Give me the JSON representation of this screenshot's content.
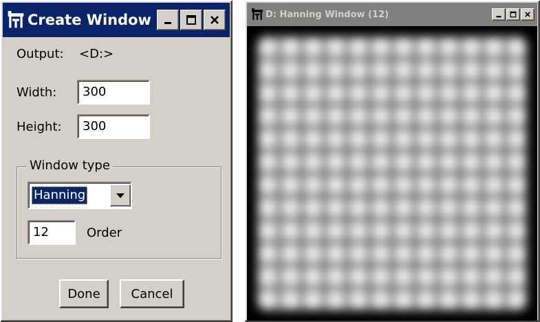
{
  "create_window": {
    "title": "Create Window",
    "controls": {
      "minimize_icon": "minimize-icon",
      "maximize_icon": "maximize-icon",
      "close_icon": "close-icon"
    },
    "output": {
      "label": "Output:",
      "value": "<D:>"
    },
    "width": {
      "label": "Width:",
      "value": "300"
    },
    "height": {
      "label": "Height:",
      "value": "300"
    },
    "window_type": {
      "legend": "Window type",
      "selected": "Hanning",
      "order_value": "12",
      "order_label": "Order"
    },
    "buttons": {
      "done": "Done",
      "cancel": "Cancel"
    }
  },
  "image_window": {
    "title": "D: Hanning Window (12)",
    "grid_tiles": 12,
    "colors": {
      "background": "#000000",
      "light": "#ffffff",
      "dark": "#8a8a8a"
    }
  },
  "colors": {
    "title_active": "#0a246a",
    "title_inactive": "#808080",
    "face": "#d4d0c8"
  }
}
